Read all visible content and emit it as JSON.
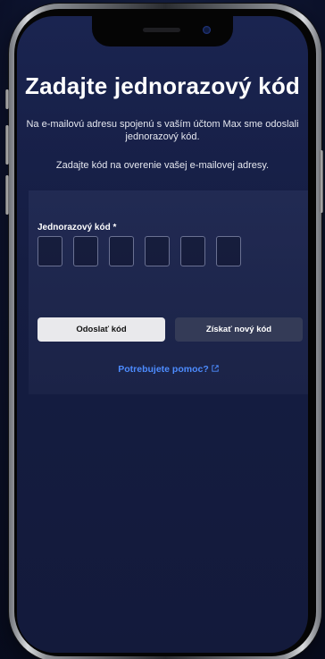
{
  "page": {
    "title": "Zadajte jednorazový kód",
    "subtitle": "Na e-mailovú adresu spojenú s vaším účtom Max sme odoslali jednorazový kód.",
    "instruction": "Zadajte kód na overenie vašej e-mailovej adresy."
  },
  "form": {
    "code_label": "Jednorazový kód *",
    "code_box_count": 6
  },
  "buttons": {
    "submit_label": "Odoslať kód",
    "resend_label": "Získať nový kód"
  },
  "help": {
    "link_label": "Potrebujete pomoc?",
    "icon": "external-link-icon"
  },
  "colors": {
    "link": "#4d8cff",
    "primary_button": "#e9e9ec",
    "secondary_button": "#343b57"
  }
}
